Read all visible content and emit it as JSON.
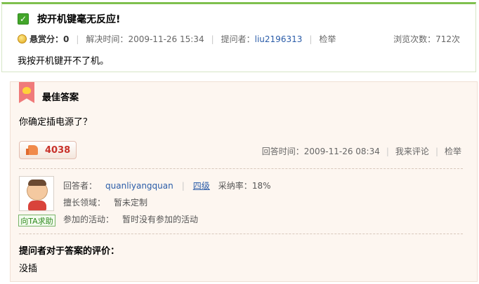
{
  "question": {
    "title": "按开机键毫无反应!",
    "reward_label": "悬赏分：",
    "reward_value": "0",
    "resolved_time_label": "解决时间：",
    "resolved_time": "2009-11-26 15:34",
    "asker_label": "提问者：",
    "asker": "liu2196313",
    "report": "检举",
    "views_label": "浏览次数：",
    "views": "712次",
    "body": "我按开机键开不了机。"
  },
  "best_answer": {
    "header": "最佳答案",
    "body": "你确定插电源了？",
    "like_count": "4038",
    "answer_time_label": "回答时间：",
    "answer_time": "2009-11-26 08:34",
    "comment_link": "我来评论",
    "report": "检举",
    "help_button": "向TA求助",
    "answerer_label": "回答者：",
    "answerer": "quanliyangquan",
    "level": "四级",
    "adoption_label": "采纳率：",
    "adoption_rate": "18%",
    "expertise_label": "擅长领域：",
    "expertise": "暂未定制",
    "activities_label": "参加的活动：",
    "activities": "暂时没有参加的活动",
    "evaluation_title": "提问者对于答案的评价：",
    "evaluation": "没插"
  },
  "colors": {
    "accent_green": "#7fc04e",
    "link_blue": "#2a5ca8",
    "like_red": "#c8312a",
    "answer_bg": "#fdf6f0"
  }
}
